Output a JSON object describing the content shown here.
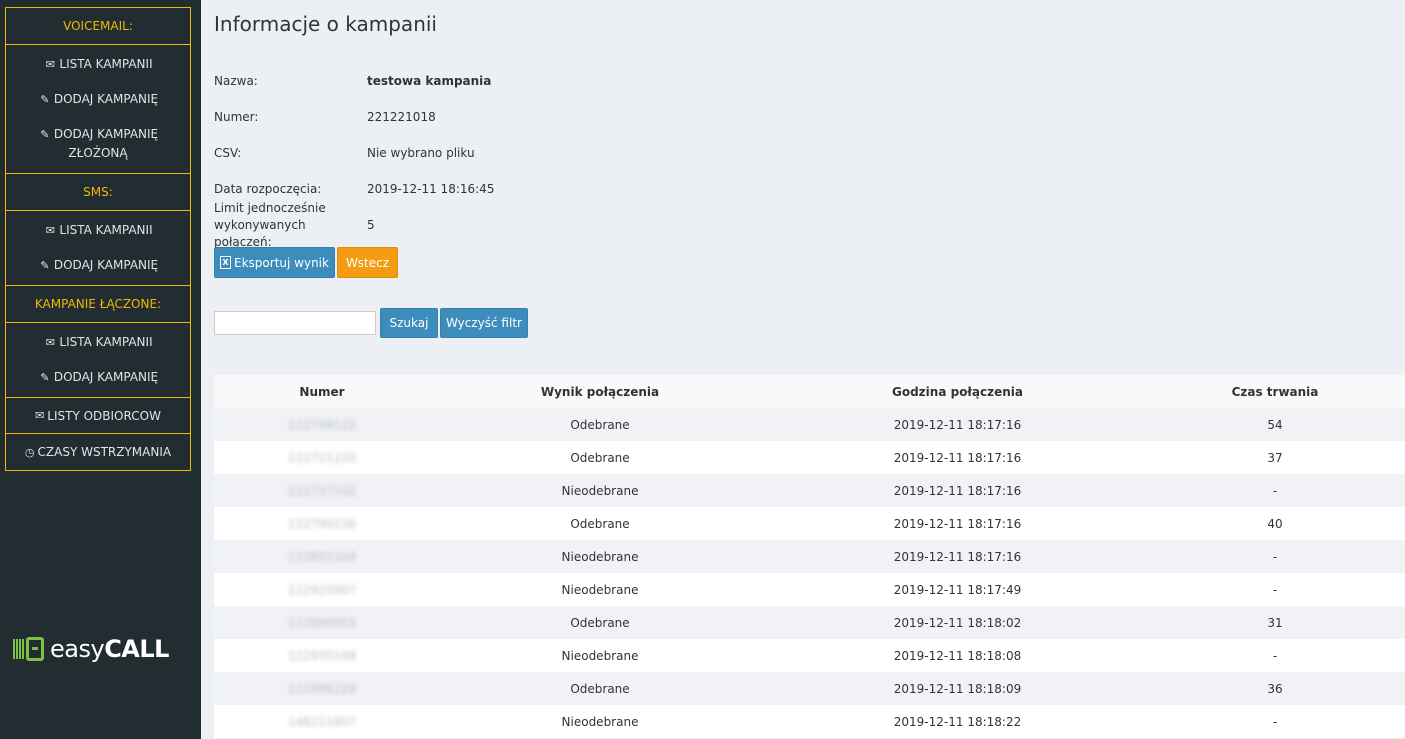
{
  "sidebar": {
    "voicemail": {
      "header": "VOICEMAIL:",
      "items": [
        {
          "icon": "envelope-icon",
          "label": "LISTA KAMPANII"
        },
        {
          "icon": "pencil-icon",
          "label": "DODAJ KAMPANIĘ"
        },
        {
          "icon": "pencil-icon",
          "label": "DODAJ KAMPANIĘ ZŁOŻONĄ"
        }
      ]
    },
    "sms": {
      "header": "SMS:",
      "items": [
        {
          "icon": "envelope-icon",
          "label": "LISTA KAMPANII"
        },
        {
          "icon": "pencil-icon",
          "label": "DODAJ KAMPANIĘ"
        }
      ]
    },
    "combined": {
      "header": "KAMPANIE ŁĄCZONE:",
      "items": [
        {
          "icon": "envelope-icon",
          "label": "LISTA KAMPANII"
        },
        {
          "icon": "pencil-icon",
          "label": "DODAJ KAMPANIĘ"
        }
      ]
    },
    "recipients": {
      "icon": "envelope-icon",
      "label": "LISTY ODBIORCOW"
    },
    "pauses": {
      "icon": "clock-icon",
      "label": "CZASY WSTRZYMANIA"
    },
    "logo_text_light": "easy",
    "logo_text_bold": "CALL"
  },
  "page": {
    "title": "Informacje o kampanii"
  },
  "info": {
    "name_label": "Nazwa:",
    "name_value": "testowa kampania",
    "number_label": "Numer:",
    "number_value": "221221018",
    "csv_label": "CSV:",
    "csv_value": "Nie wybrano pliku",
    "start_label": "Data rozpoczęcia:",
    "start_value": "2019-12-11 18:16:45",
    "limit_label": "Limit jednocześnie wykonywanych połączeń:",
    "limit_value": "5"
  },
  "actions": {
    "export_label": "Eksportuj wynik",
    "back_label": "Wstecz"
  },
  "search": {
    "input_value": "",
    "search_label": "Szukaj",
    "clear_label": "Wyczyść filtr"
  },
  "table": {
    "headers": [
      "Numer",
      "Wynik połączenia",
      "Godzina połączenia",
      "Czas trwania"
    ],
    "rows": [
      {
        "number": "122799122",
        "result": "Odebrane",
        "time": "2019-12-11 18:17:16",
        "duration": "54"
      },
      {
        "number": "122721220",
        "result": "Odebrane",
        "time": "2019-12-11 18:17:16",
        "duration": "37"
      },
      {
        "number": "122737102",
        "result": "Nieodebrane",
        "time": "2019-12-11 18:17:16",
        "duration": "-"
      },
      {
        "number": "122790156",
        "result": "Odebrane",
        "time": "2019-12-11 18:17:16",
        "duration": "40"
      },
      {
        "number": "122855104",
        "result": "Nieodebrane",
        "time": "2019-12-11 18:17:16",
        "duration": "-"
      },
      {
        "number": "122920907",
        "result": "Nieodebrane",
        "time": "2019-12-11 18:17:49",
        "duration": "-"
      },
      {
        "number": "122890055",
        "result": "Odebrane",
        "time": "2019-12-11 18:18:02",
        "duration": "31"
      },
      {
        "number": "122935108",
        "result": "Nieodebrane",
        "time": "2019-12-11 18:18:08",
        "duration": "-"
      },
      {
        "number": "122996228",
        "result": "Odebrane",
        "time": "2019-12-11 18:18:09",
        "duration": "36"
      },
      {
        "number": "148211807",
        "result": "Nieodebrane",
        "time": "2019-12-11 18:18:22",
        "duration": "-"
      }
    ]
  },
  "colors": {
    "sidebar_bg": "#222d32",
    "accent_yellow": "#f2b705",
    "primary_blue": "#3c8dbc",
    "warning_orange": "#f39c12",
    "logo_green": "#7cc242"
  }
}
